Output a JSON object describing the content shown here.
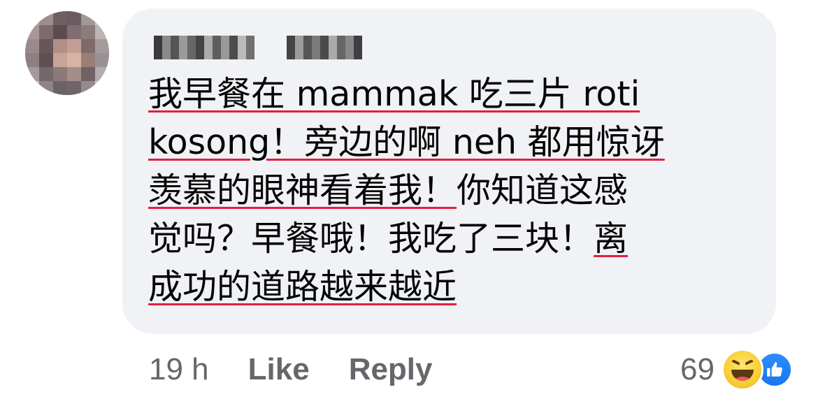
{
  "comment": {
    "author_name": "Aaron Liew",
    "lines": [
      {
        "text": "我早餐在 mammak 吃三片 roti",
        "underline": true
      },
      {
        "text": "kosong！旁边的啊 neh 都用惊讶",
        "underline": true
      },
      {
        "text_underlined": "羡慕的眼神看着我！",
        "text_plain": "你知道这感"
      },
      {
        "text_plain": "觉吗？早餐哦！我吃了三块！",
        "text_underlined": "离"
      },
      {
        "text": "成功的道路越来越近",
        "underline": true
      }
    ]
  },
  "actions": {
    "timestamp": "19 h",
    "like_label": "Like",
    "reply_label": "Reply"
  },
  "reactions": {
    "count": "69",
    "icons": [
      "haha-icon",
      "like-icon"
    ]
  },
  "colors": {
    "bubble_bg": "#f0f2f5",
    "text": "#050505",
    "secondary_text": "#65676b",
    "underline_red": "#e41e3f",
    "like_blue": "#1877f2",
    "haha_yellow": "#f9ce34"
  }
}
